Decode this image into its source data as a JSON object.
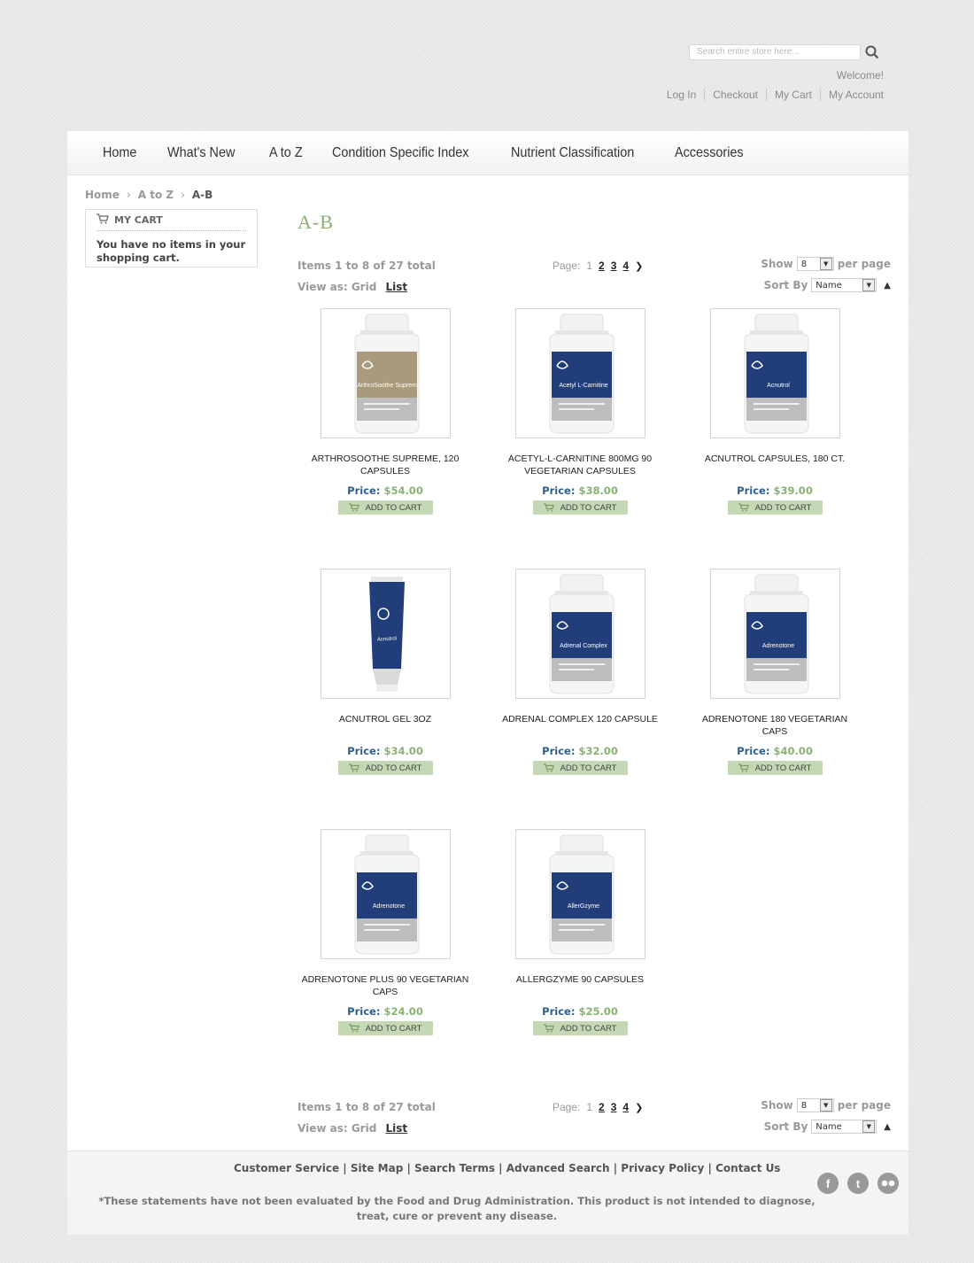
{
  "header": {
    "search_placeholder": "Search entire store here...",
    "welcome": "Welcome!",
    "links": [
      "Log In",
      "Checkout",
      "My Cart",
      "My Account"
    ]
  },
  "nav": [
    "Home",
    "What's New",
    "A to Z",
    "Condition Specific Index",
    "Nutrient Classification",
    "Accessories"
  ],
  "breadcrumb": [
    "Home",
    "A to Z",
    "A-B"
  ],
  "cart": {
    "title": "MY CART",
    "empty_message": "You have no items in your shopping cart."
  },
  "page_title": "A-B",
  "toolbar": {
    "items_text": "Items 1 to 8 of 27 total",
    "view_as": "View as:",
    "view_grid": "Grid",
    "view_list": "List",
    "page_label": "Page:",
    "pages": [
      "1",
      "2",
      "3",
      "4"
    ],
    "show_label": "Show",
    "show_value": "8",
    "per_page": "per page",
    "sort_label": "Sort By",
    "sort_value": "Name"
  },
  "products": [
    {
      "name": "ARTHROSOOTHE SUPREME, 120 CAPSULES",
      "price": "$54.00",
      "label_color": "#a89a7a",
      "label_text": "ArthroSoothe Supreme",
      "type": "bottle"
    },
    {
      "name": "ACETYL-L-CARNITINE 800MG 90 VEGETARIAN CAPSULES",
      "price": "$38.00",
      "label_color": "#213e7a",
      "label_text": "Acetyl L-Carnitine",
      "type": "bottle"
    },
    {
      "name": "ACNUTROL CAPSULES, 180 CT.",
      "price": "$39.00",
      "label_color": "#213e7a",
      "label_text": "Acnutrol",
      "type": "bottle"
    },
    {
      "name": "ACNUTROL GEL 3OZ",
      "price": "$34.00",
      "label_color": "#213e7a",
      "label_text": "Acnutrol",
      "type": "tube"
    },
    {
      "name": "ADRENAL COMPLEX 120 CAPSULE",
      "price": "$32.00",
      "label_color": "#213e7a",
      "label_text": "Adrenal Complex",
      "type": "bottle"
    },
    {
      "name": "ADRENOTONE 180 VEGETARIAN CAPS",
      "price": "$40.00",
      "label_color": "#213e7a",
      "label_text": "Adrenotone",
      "type": "bottle"
    },
    {
      "name": "ADRENOTONE PLUS 90 VEGETARIAN CAPS",
      "price": "$24.00",
      "label_color": "#213e7a",
      "label_text": "Adrenotone",
      "type": "bottle"
    },
    {
      "name": "ALLERGZYME 90 CAPSULES",
      "price": "$25.00",
      "label_color": "#213e7a",
      "label_text": "AllerGzyme",
      "type": "bottle"
    }
  ],
  "product_labels": {
    "price_label": "Price:",
    "add_to_cart": "ADD TO CART"
  },
  "footer": {
    "links": [
      "Customer Service",
      "Site Map",
      "Search Terms",
      "Advanced Search",
      "Privacy Policy",
      "Contact Us"
    ],
    "disclaimer": "*These statements have not been evaluated by the Food and Drug Administration. This product is not intended to diagnose, treat, cure or prevent any disease.",
    "social": [
      "facebook-icon",
      "tumblr-icon",
      "flickr-icon"
    ]
  }
}
